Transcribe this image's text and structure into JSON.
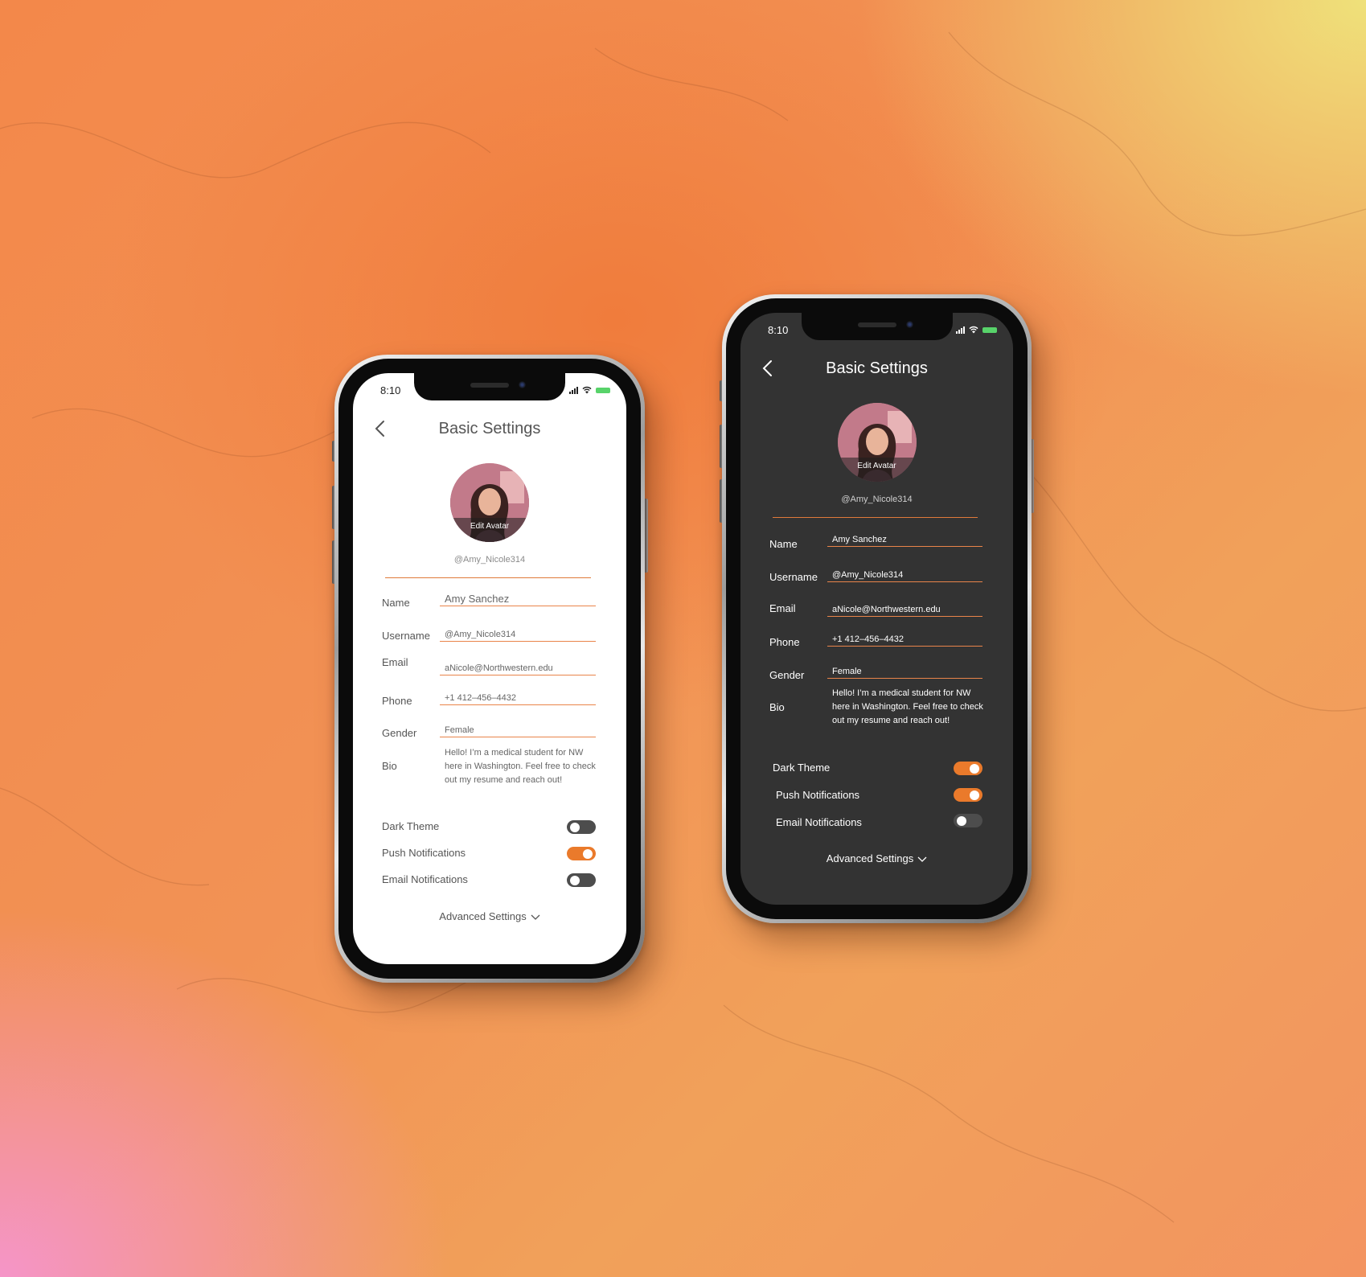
{
  "colors": {
    "accent": "#ea7a2b",
    "toggle_off": "#4d4d4d",
    "dark_bg": "#333333",
    "light_bg": "#ffffff",
    "battery": "#58d36a"
  },
  "icons": [
    "back-chevron-icon",
    "signal-icon",
    "wifi-icon",
    "battery-icon",
    "chevron-down-icon"
  ],
  "light_phone": {
    "status_time": "8:10",
    "title": "Basic Settings",
    "avatar_label": "Edit Avatar",
    "handle": "@Amy_Nicole314",
    "fields": {
      "name": {
        "label": "Name",
        "value": "Amy Sanchez"
      },
      "username": {
        "label": "Username",
        "value": "@Amy_Nicole314"
      },
      "email": {
        "label": "Email",
        "value": "aNicole@Northwestern.edu"
      },
      "phone": {
        "label": "Phone",
        "value": "+1 412–456–4432"
      },
      "gender": {
        "label": "Gender",
        "value": "Female"
      },
      "bio": {
        "label": "Bio",
        "value": "Hello! I’m a medical student for NW here in Washington. Feel free to check out my resume and reach out!"
      }
    },
    "toggles": {
      "dark_theme": {
        "label": "Dark Theme",
        "on": false
      },
      "push_notifications": {
        "label": "Push Notifications",
        "on": true
      },
      "email_notifications": {
        "label": "Email Notifications",
        "on": false
      }
    },
    "advanced_label": "Advanced Settings"
  },
  "dark_phone": {
    "status_time": "8:10",
    "title": "Basic Settings",
    "avatar_label": "Edit Avatar",
    "handle": "@Amy_Nicole314",
    "fields": {
      "name": {
        "label": "Name",
        "value": "Amy Sanchez"
      },
      "username": {
        "label": "Username",
        "value": "@Amy_Nicole314"
      },
      "email": {
        "label": "Email",
        "value": "aNicole@Northwestern.edu"
      },
      "phone": {
        "label": "Phone",
        "value": "+1 412–456–4432"
      },
      "gender": {
        "label": "Gender",
        "value": "Female"
      },
      "bio": {
        "label": "Bio",
        "value": "Hello! I’m a medical student for NW here in Washington. Feel free to check out my resume and reach out!"
      }
    },
    "toggles": {
      "dark_theme": {
        "label": "Dark Theme",
        "on": true
      },
      "push_notifications": {
        "label": "Push Notifications",
        "on": true
      },
      "email_notifications": {
        "label": "Email Notifications",
        "on": false
      }
    },
    "advanced_label": "Advanced Settings"
  }
}
